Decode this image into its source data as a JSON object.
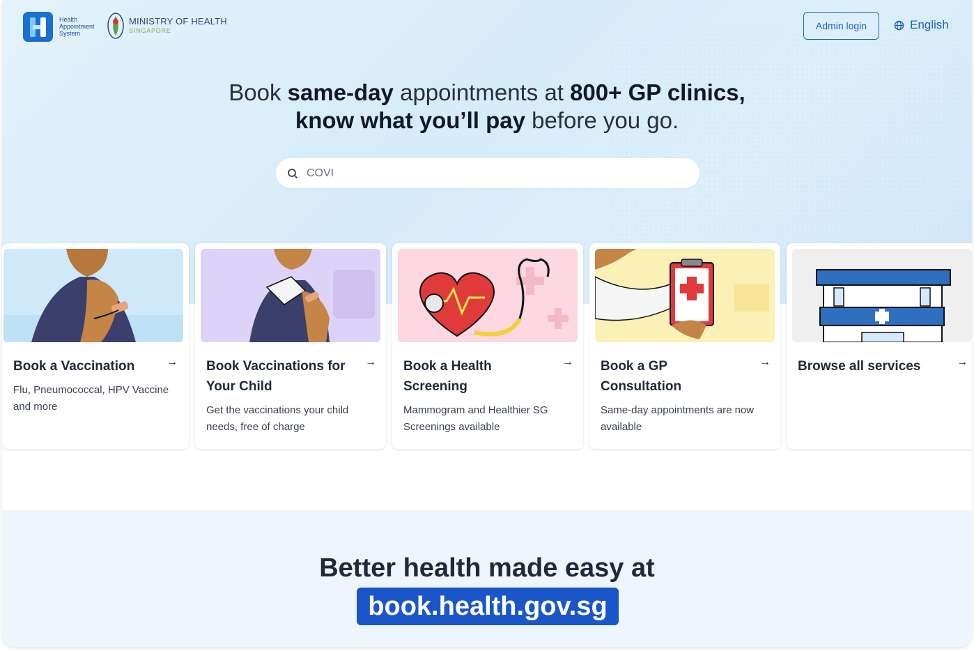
{
  "header": {
    "has_logo_text": "Health Appointment System",
    "moh_title": "MINISTRY OF HEALTH",
    "moh_subtitle": "SINGAPORE",
    "admin_login_label": "Admin login",
    "language_label": "English"
  },
  "hero": {
    "line1_part1": "Book ",
    "line1_bold1": "same-day",
    "line1_part2": " appointments at ",
    "line1_bold2": "800+ GP clinics,",
    "line2_bold": "know what you’ll pay",
    "line2_part": " before you go."
  },
  "search": {
    "value": "COVI",
    "placeholder": ""
  },
  "cards": [
    {
      "title": "Book a Vaccination",
      "description": "Flu, Pneumococcal, HPV Vaccine and more"
    },
    {
      "title": "Book Vaccinations for Your Child",
      "description": "Get the vaccinations your child needs, free of charge"
    },
    {
      "title": "Book a Health Screening",
      "description": "Mammogram and Healthier SG Screenings available"
    },
    {
      "title": "Book a GP Consultation",
      "description": "Same-day appointments are now available"
    },
    {
      "title": "Browse all services",
      "description": ""
    }
  ],
  "bottom": {
    "title": "Better health made easy at",
    "url": "book.health.gov.sg"
  },
  "colors": {
    "brand_blue": "#1a56c8",
    "link_blue": "#1f5fb8",
    "hero_bg": "#d6ecf8"
  },
  "icons": [
    "search-icon",
    "globe-icon",
    "arrow-right-icon"
  ]
}
